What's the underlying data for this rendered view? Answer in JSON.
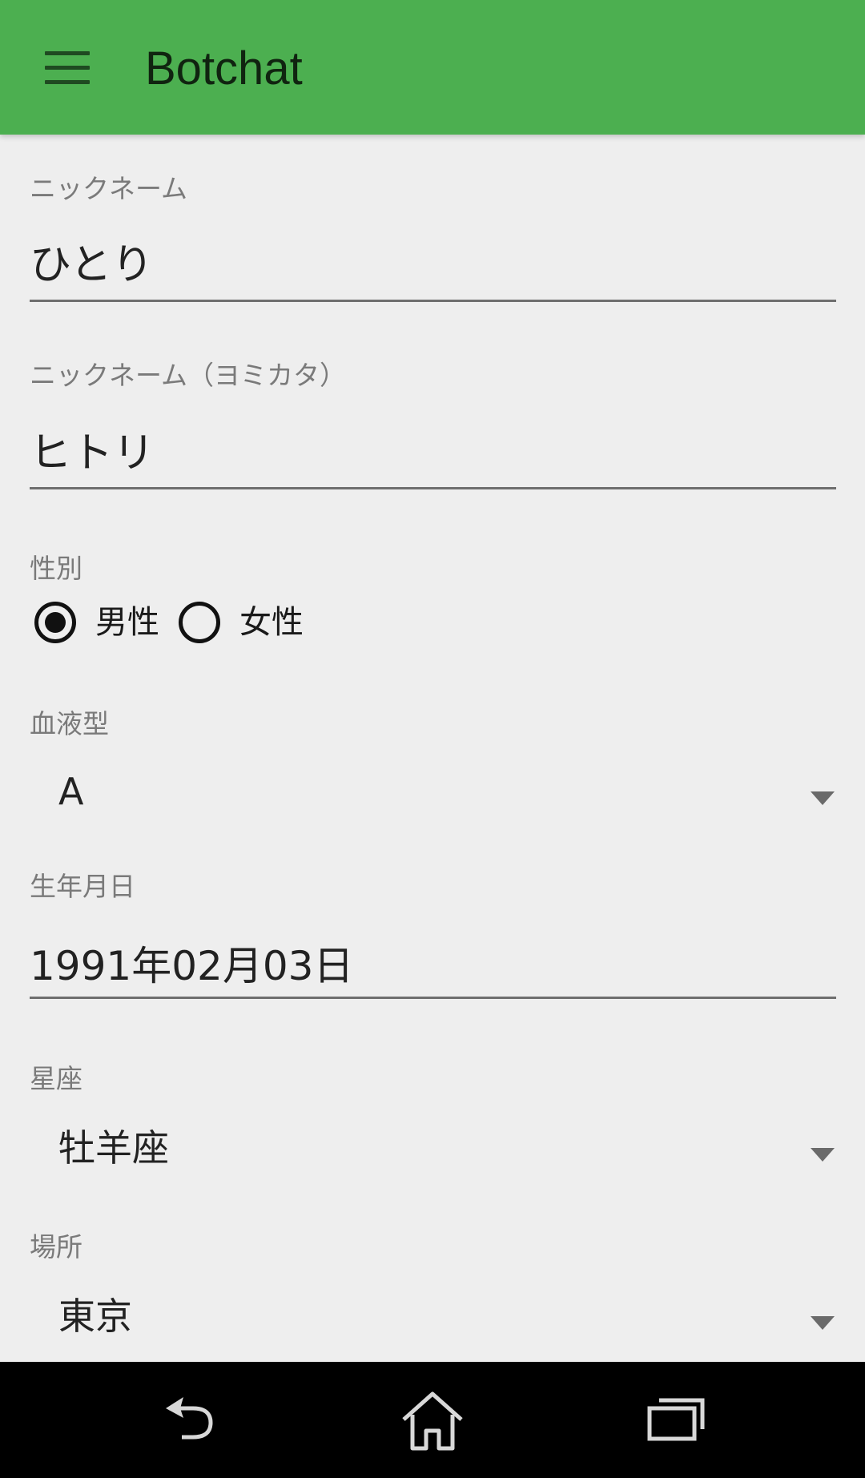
{
  "app_bar": {
    "title": "Botchat",
    "menu_icon": "hamburger-menu-icon",
    "background_color": "#4caf50"
  },
  "form": {
    "nickname": {
      "label": "ニックネーム",
      "value": "ひとり"
    },
    "nickname_reading": {
      "label": "ニックネーム（ヨミカタ）",
      "value": "ヒトリ"
    },
    "gender": {
      "label": "性別",
      "options": [
        {
          "label": "男性",
          "selected": true
        },
        {
          "label": "女性",
          "selected": false
        }
      ]
    },
    "blood_type": {
      "label": "血液型",
      "selected": "A"
    },
    "birthday": {
      "label": "生年月日",
      "value": "1991年02月03日"
    },
    "zodiac": {
      "label": "星座",
      "selected": "牡羊座"
    },
    "location": {
      "label": "場所",
      "selected": "東京"
    }
  },
  "nav_bar": {
    "buttons": [
      {
        "icon": "back-icon"
      },
      {
        "icon": "home-icon"
      },
      {
        "icon": "recent-apps-icon"
      }
    ]
  }
}
